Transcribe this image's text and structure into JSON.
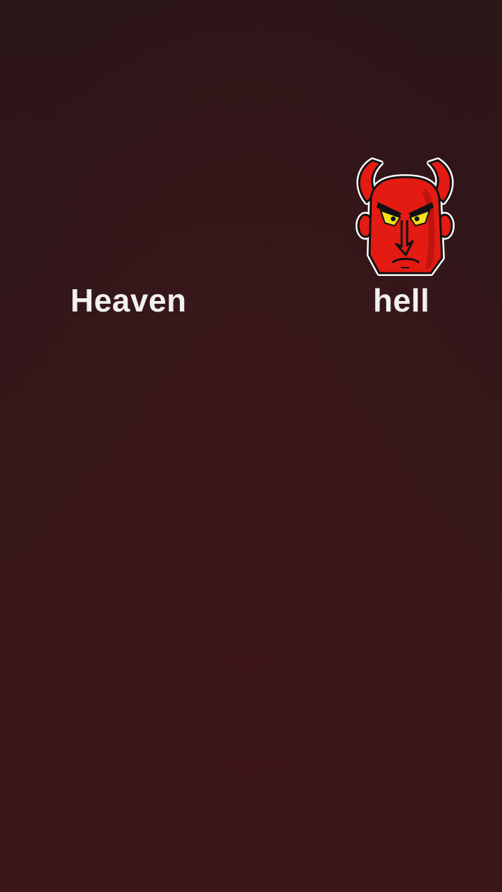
{
  "labels": {
    "heaven": "Heaven",
    "hell": "hell"
  },
  "stickers": {
    "devil": {
      "icon": "devil-face-icon",
      "skin_color": "#e31b12",
      "eye_color": "#f5e21a"
    }
  },
  "colors": {
    "background": "#33171a",
    "text": "#f2f0f0"
  }
}
